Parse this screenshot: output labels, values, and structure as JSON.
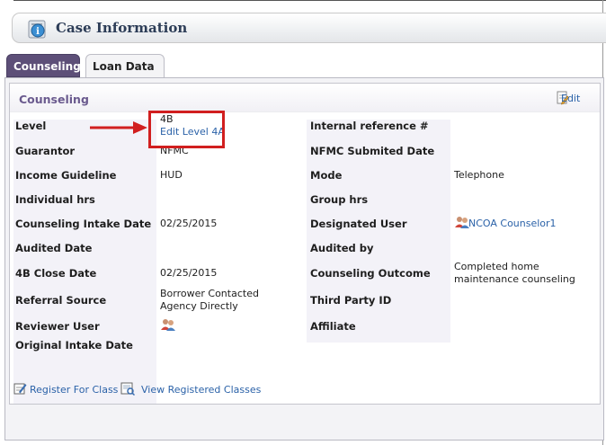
{
  "header": {
    "title": "Case Information",
    "icon": "info-icon"
  },
  "tabs": [
    {
      "label": "Counseling",
      "active": true
    },
    {
      "label": "Loan Data",
      "active": false
    }
  ],
  "panel": {
    "title": "Counseling",
    "edit_label": "Edit",
    "rows": {
      "level": {
        "label": "Level",
        "value": "4B",
        "link": "Edit Level 4A"
      },
      "internal_ref": {
        "label": "Internal reference #",
        "value": ""
      },
      "guarantor": {
        "label": "Guarantor",
        "value": "NFMC"
      },
      "nfmc_submitted": {
        "label": "NFMC Submited Date",
        "value": ""
      },
      "income_guideline": {
        "label": "Income Guideline",
        "value": "HUD"
      },
      "mode": {
        "label": "Mode",
        "value": "Telephone"
      },
      "individual_hrs": {
        "label": "Individual hrs",
        "value": ""
      },
      "group_hrs": {
        "label": "Group hrs",
        "value": ""
      },
      "intake_date": {
        "label": "Counseling Intake Date",
        "value": "02/25/2015"
      },
      "designated_user": {
        "label": "Designated User",
        "value": "NCOA Counselor1"
      },
      "audited_date": {
        "label": "Audited Date",
        "value": ""
      },
      "audited_by": {
        "label": "Audited by",
        "value": ""
      },
      "close_date": {
        "label": "4B Close Date",
        "value": "02/25/2015"
      },
      "outcome": {
        "label": "Counseling Outcome",
        "value": "Completed home maintenance counseling"
      },
      "referral_source": {
        "label": "Referral Source",
        "value": "Borrower Contacted Agency Directly"
      },
      "third_party_id": {
        "label": "Third Party ID",
        "value": ""
      },
      "reviewer_user": {
        "label": "Reviewer User",
        "value": ""
      },
      "affiliate": {
        "label": "Affiliate",
        "value": ""
      },
      "original_intake": {
        "label": "Original Intake Date",
        "value": ""
      }
    }
  },
  "footer": {
    "register_label": "Register For Class",
    "view_label": "View Registered Classes"
  },
  "colors": {
    "accent_tab": "#5d4f78",
    "link": "#2b62a8",
    "highlight": "#d11f1f"
  }
}
